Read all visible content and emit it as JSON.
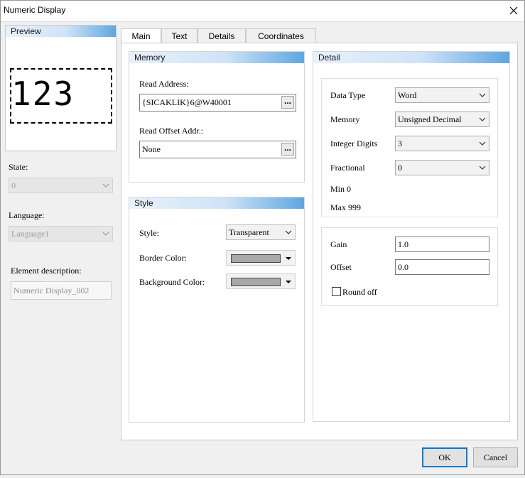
{
  "window": {
    "title": "Numeric Display"
  },
  "preview": {
    "label": "Preview",
    "value": "123"
  },
  "left": {
    "state_label": "State:",
    "state_value": "0",
    "language_label": "Language:",
    "language_value": "Language1",
    "description_label": "Element description:",
    "description_value": "Numeric Display_002"
  },
  "tabs": [
    {
      "label": "Main",
      "active": true
    },
    {
      "label": "Text",
      "active": false
    },
    {
      "label": "Details",
      "active": false
    },
    {
      "label": "Coordinates",
      "active": false
    }
  ],
  "memory": {
    "title": "Memory",
    "read_address_label": "Read Address:",
    "read_address_value": "{SICAKLIK}6@W40001",
    "read_offset_label": "Read Offset Addr.:",
    "read_offset_value": "None",
    "browse_label": "..."
  },
  "style": {
    "title": "Style",
    "style_label": "Style:",
    "style_value": "Transparent",
    "border_color_label": "Border Color:",
    "background_color_label": "Background Color:",
    "border_color": "#a8a8a8",
    "background_color": "#a8a8a8"
  },
  "detail": {
    "title": "Detail",
    "data_type_label": "Data Type",
    "data_type_value": "Word",
    "memory_label": "Memory",
    "memory_value": "Unsigned Decimal",
    "integer_digits_label": "Integer Digits",
    "integer_digits_value": "3",
    "fractional_label": "Fractional",
    "fractional_value": "0",
    "min_text": "Min 0",
    "max_text": "Max 999",
    "gain_label": "Gain",
    "gain_value": "1.0",
    "offset_label": "Offset",
    "offset_value": "0.0",
    "round_off_label": "Round off",
    "round_off_checked": false
  },
  "buttons": {
    "ok": "OK",
    "cancel": "Cancel"
  },
  "colors": {
    "accent": "#0078d7",
    "header_gradient_end": "#5fa6e0"
  }
}
